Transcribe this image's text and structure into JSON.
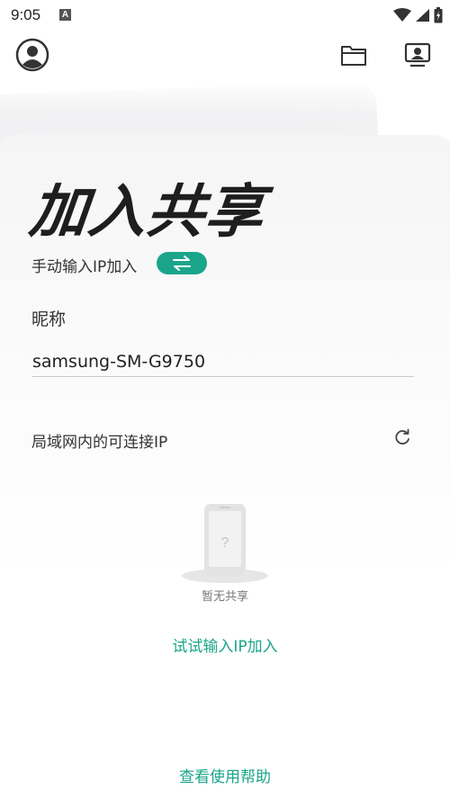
{
  "status_bar": {
    "time": "9:05",
    "a_icon": "A"
  },
  "top_bar": {
    "avatar_icon": "user-avatar-icon",
    "folder_icon": "folder-icon",
    "screen_icon": "screen-share-icon"
  },
  "main": {
    "title": "加入共享",
    "manual_label": "手动输入IP加入",
    "switch_icon": "swap-arrows-icon",
    "nickname_label": "昵称",
    "nickname_value": "samsung-SM-G9750",
    "lan_label": "局域网内的可连接IP",
    "refresh_icon": "refresh-icon",
    "empty_text": "暂无共享",
    "try_link": "试试输入IP加入",
    "help_link": "查看使用帮助"
  },
  "colors": {
    "accent": "#1aa58a",
    "text": "#2b2b2b"
  }
}
